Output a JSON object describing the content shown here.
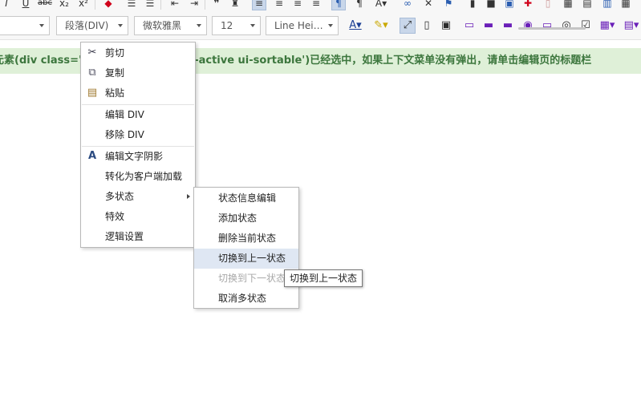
{
  "toolbar": {
    "paragraph_format": "段落(DIV)",
    "font_family": "微软雅黑",
    "font_size": "12",
    "line_height": "Line Hei…"
  },
  "notice": {
    "text": "元素(div class='         tus-active ui-sortable')已经选中，如果上下文菜单没有弹出，请单击编辑页的标题栏"
  },
  "context_menu": {
    "items": [
      {
        "label": "剪切",
        "icon": "scissors-icon"
      },
      {
        "label": "复制",
        "icon": "copy-icon"
      },
      {
        "label": "粘贴",
        "icon": "paste-icon"
      },
      {
        "label": "编辑 DIV"
      },
      {
        "label": "移除 DIV"
      },
      {
        "label": "编辑文字阴影",
        "icon": "text-shadow-icon"
      },
      {
        "label": "转化为客户端加载"
      },
      {
        "label": "多状态",
        "has_submenu": true
      },
      {
        "label": "特效"
      },
      {
        "label": "逻辑设置"
      }
    ]
  },
  "submenu": {
    "items": [
      {
        "label": "状态信息编辑"
      },
      {
        "label": "添加状态"
      },
      {
        "label": "删除当前状态"
      },
      {
        "label": "切换到上一状态",
        "state": "hovered"
      },
      {
        "label": "切换到下一状态",
        "state": "disabled"
      },
      {
        "label": "取消多状态"
      }
    ]
  },
  "tooltip": {
    "text": "切换到上一状态"
  },
  "colors": {
    "notice_bg": "#dff0d8",
    "notice_text": "#3c763d",
    "hover_bg": "#dfe7f3"
  }
}
